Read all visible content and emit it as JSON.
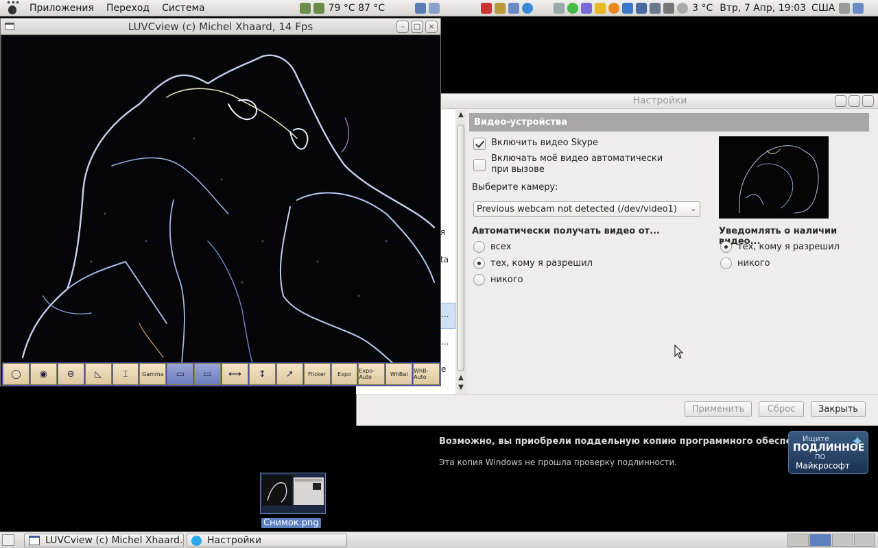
{
  "top_panel": {
    "menus": [
      "Приложения",
      "Переход",
      "Система"
    ],
    "temps": "79 °C 87 °C",
    "weather": "3 °C",
    "clock": "Втр,  7 Апр, 19:03",
    "keyboard_layout": "США"
  },
  "luvc_window": {
    "title": "LUVCview (c) Michel Xhaard, 14 Fps",
    "toolbar": [
      {
        "label": "",
        "sym": "◯"
      },
      {
        "label": "",
        "sym": "◉"
      },
      {
        "label": "",
        "sym": "⊖"
      },
      {
        "label": "",
        "sym": "◺"
      },
      {
        "label": "",
        "sym": "⌶"
      },
      {
        "label": "Gamma",
        "sym": ""
      },
      {
        "label": "",
        "sym": "▭"
      },
      {
        "label": "",
        "sym": "▭"
      },
      {
        "label": "",
        "sym": "⟷"
      },
      {
        "label": "",
        "sym": "↕"
      },
      {
        "label": "",
        "sym": "↗"
      },
      {
        "label": "Flicker",
        "sym": ""
      },
      {
        "label": "Expo",
        "sym": ""
      },
      {
        "label": "Expo-Auto",
        "sym": ""
      },
      {
        "label": "WhBal",
        "sym": ""
      },
      {
        "label": "WhB-Auto",
        "sym": ""
      }
    ]
  },
  "settings_window": {
    "title": "Настройки",
    "section_header": "Видео-устройства",
    "enable_video": {
      "label": "Включить видео Skype",
      "checked": true
    },
    "auto_video": {
      "label_line1": "Включать моё видео автоматически",
      "label_line2": "при вызове",
      "checked": false
    },
    "camera_label": "Выберите камеру:",
    "camera_value": "Previous webcam not detected (/dev/video1)",
    "receive_group": {
      "title": "Автоматически получать видео от...",
      "options": [
        "всех",
        "тех, кому я разрешил",
        "никого"
      ],
      "selected": 1
    },
    "notify_group": {
      "title": "Уведомлять о наличии видео...",
      "options": [
        "тех, кому я разрешил",
        "никого"
      ],
      "selected": 0
    },
    "buttons": {
      "apply": "Применить",
      "reset": "Сброс",
      "close": "Закрыть"
    },
    "sidebar_fragments": [
      "я",
      "ta",
      "...",
      "...",
      "e"
    ]
  },
  "watermark": {
    "line1": "Возможно, вы приобрели поддельную копию программного обеспечения.",
    "line2": "Эта копия Windows не прошла проверку подлинности.",
    "badge": {
      "l1": "Ищите",
      "l2": "ПОДЛИННОЕ",
      "l3": "ПО",
      "l4": "Майкрософт"
    }
  },
  "desktop_icon": {
    "label": "Снимок.png"
  },
  "taskbar": {
    "tasks": [
      "LUVCview (c) Michel Xhaard...",
      "Настройки"
    ]
  },
  "colors": {
    "accent": "#5b7fbf",
    "header_gray": "#a9a7a3"
  }
}
